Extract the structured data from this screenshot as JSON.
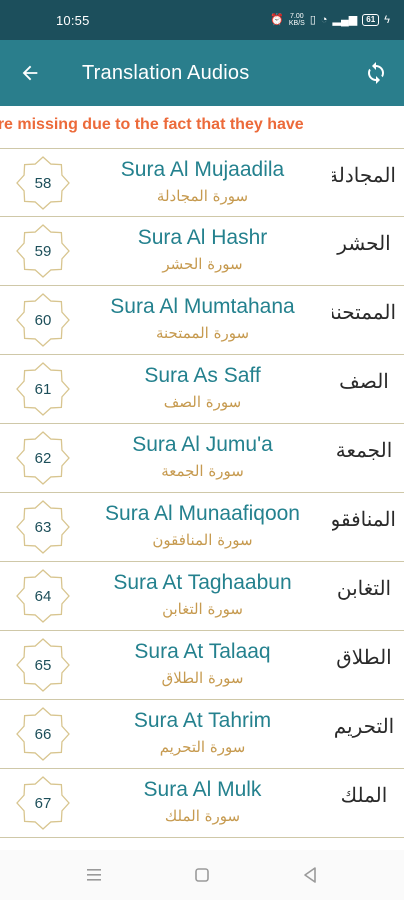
{
  "status_bar": {
    "time": "10:55",
    "network_speed": "7.00\nKB/S",
    "battery_level": "61",
    "icons": [
      "alarm-icon",
      "vibrate-icon",
      "wifi-icon",
      "signal-icon",
      "battery-icon",
      "charging-icon"
    ]
  },
  "app_bar": {
    "title": "Translation Audios",
    "back_icon": "arrow-left-icon",
    "refresh_icon": "refresh-icon",
    "color": "#2a7e8c"
  },
  "notice": {
    "text": "Suras are missing due to the fact that they have",
    "color": "#ec6a3a"
  },
  "suras": [
    {
      "number": "58",
      "title": "Sura Al Mujaadila",
      "subtitle": "ﺳﻮﺭﺓ ﺍﻟﻤﺠﺎﺩﻟﺔ",
      "calligraphy": "ﺍﻟﻤﺠﺎﺩﻟﺔ"
    },
    {
      "number": "59",
      "title": "Sura Al Hashr",
      "subtitle": "ﺳﻮﺭﺓ ﺍﻟﺤﺸﺮ",
      "calligraphy": "ﺍﻟﺤﺸﺮ"
    },
    {
      "number": "60",
      "title": "Sura Al Mumtahana",
      "subtitle": "ﺳﻮﺭﺓ ﺍﻟﻤﻤﺘﺤﻨﺔ",
      "calligraphy": "ﺍﻟﻤﻤﺘﺤﻨﺔ"
    },
    {
      "number": "61",
      "title": "Sura As Saff",
      "subtitle": "ﺳﻮﺭﺓ ﺍﻟﺼﻒ",
      "calligraphy": "ﺍﻟﺼﻒ"
    },
    {
      "number": "62",
      "title": "Sura Al Jumu'a",
      "subtitle": "ﺳﻮﺭﺓ ﺍﻟﺠﻤﻌﺔ",
      "calligraphy": "ﺍﻟﺠﻤﻌﺔ"
    },
    {
      "number": "63",
      "title": "Sura Al Munaafiqoon",
      "subtitle": "ﺳﻮﺭﺓ ﺍﻟﻤﻨﺎﻓﻘﻮﻥ",
      "calligraphy": "ﺍﻟﻤﻨﺎﻓﻘﻮﻥ"
    },
    {
      "number": "64",
      "title": "Sura At Taghaabun",
      "subtitle": "ﺳﻮﺭﺓ ﺍﻟﺘﻐﺎﺑﻦ",
      "calligraphy": "ﺍﻟﺘﻐﺎﺑﻦ"
    },
    {
      "number": "65",
      "title": "Sura At Talaaq",
      "subtitle": "ﺳﻮﺭﺓ ﺍﻟﻄﻼﻕ",
      "calligraphy": "ﺍﻟﻄﻼﻕ"
    },
    {
      "number": "66",
      "title": "Sura At Tahrim",
      "subtitle": "ﺳﻮﺭﺓ ﺍﻟﺘﺤﺮﻳﻢ",
      "calligraphy": "ﺍﻟﺘﺤﺮﻳﻢ"
    },
    {
      "number": "67",
      "title": "Sura Al Mulk",
      "subtitle": "ﺳﻮﺭﺓ ﺍﻟﻤﻠﻚ",
      "calligraphy": "ﺍﻟﻤﻠﻚ"
    }
  ],
  "colors": {
    "status_bar": "#1c4f5c",
    "title_text": "#24818e",
    "subtitle_text": "#c69a4f",
    "badge_stroke": "#d8c58f",
    "divider": "#cfc8a8"
  },
  "nav_bar": {
    "icons": [
      "menu-icon",
      "home-square-icon",
      "back-triangle-icon"
    ]
  }
}
